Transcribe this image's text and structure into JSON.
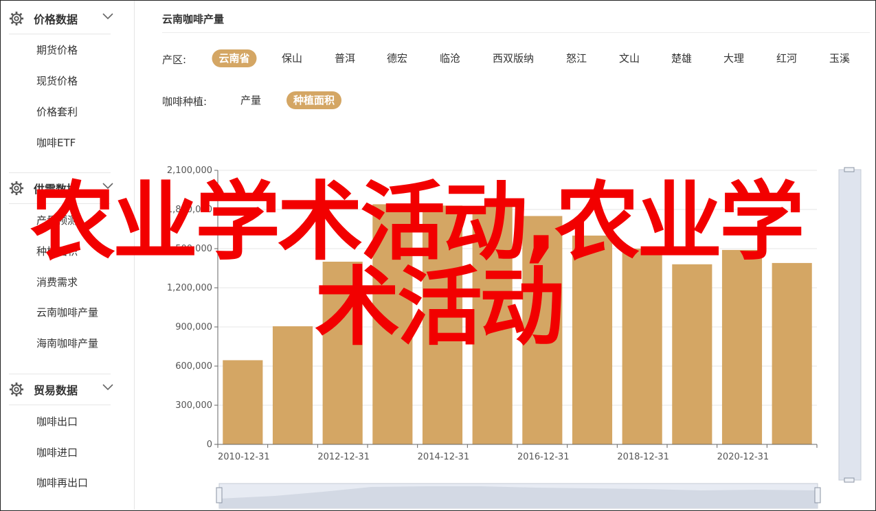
{
  "sidebar": {
    "sections": [
      {
        "title": "价格数据",
        "icon": "gear-icon",
        "items": [
          "期货价格",
          "现货价格",
          "价格套利",
          "咖啡ETF"
        ]
      },
      {
        "title": "供需数据",
        "icon": "gear-icon",
        "items": [
          "产量预测",
          "种植面积",
          "消费需求",
          "云南咖啡产量",
          "海南咖啡产量"
        ]
      },
      {
        "title": "贸易数据",
        "icon": "gear-icon",
        "items": [
          "咖啡出口",
          "咖啡进口",
          "咖啡再出口"
        ]
      }
    ]
  },
  "main": {
    "title": "云南咖啡产量",
    "region_filter": {
      "label": "产区:",
      "options": [
        "云南省",
        "保山",
        "普洱",
        "德宏",
        "临沧",
        "西双版纳",
        "怒江",
        "文山",
        "楚雄",
        "大理",
        "红河",
        "玉溪"
      ],
      "selected": "云南省"
    },
    "type_filter": {
      "label": "咖啡种植:",
      "options": [
        "产量",
        "种植面积"
      ],
      "selected": "种植面积"
    }
  },
  "overlay": {
    "text_line1": "农业学术活动,农业学",
    "text_line2": "术活动",
    "color": "#f20000"
  },
  "colors": {
    "accent": "#d4a664",
    "bar": "#d4a664"
  },
  "chart_data": {
    "type": "bar",
    "categories": [
      "2010-12-31",
      "2011-12-31",
      "2012-12-31",
      "2013-12-31",
      "2014-12-31",
      "2015-12-31",
      "2016-12-31",
      "2017-12-31",
      "2018-12-31",
      "2019-12-31",
      "2020-12-31",
      "2021-12-31"
    ],
    "x_tick_labels": [
      "2010-12-31",
      "2012-12-31",
      "2014-12-31",
      "2016-12-31",
      "2018-12-31",
      "2020-12-31"
    ],
    "values": [
      645000,
      905000,
      1400000,
      1840000,
      1830000,
      1820000,
      1750000,
      1600000,
      1500000,
      1380000,
      1490000,
      1390000
    ],
    "ylim": [
      0,
      2100000
    ],
    "y_ticks": [
      0,
      300000,
      600000,
      900000,
      1200000,
      1500000,
      1800000,
      2100000
    ],
    "y_tick_labels": [
      "0",
      "300,000",
      "600,000",
      "900,000",
      "1,200,000",
      "1,500,000",
      "1,800,000",
      "2,100,000"
    ],
    "title": "",
    "xlabel": "",
    "ylabel": "",
    "grid": true
  }
}
